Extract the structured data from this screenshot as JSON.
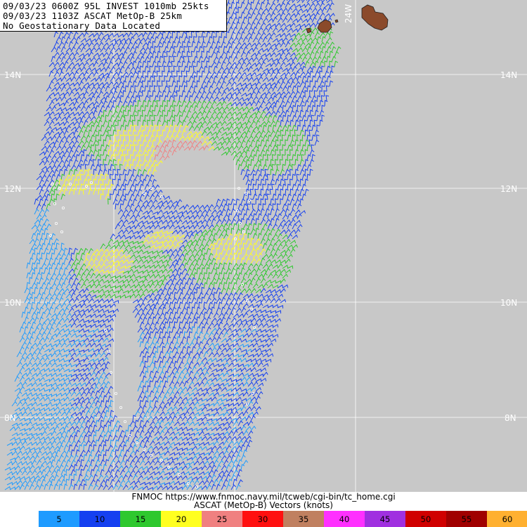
{
  "header": {
    "line1": "09/03/23 0600Z  95L INVEST 1010mb 25kts",
    "line2": "09/03/23 1103Z  ASCAT MetOp-B 25km",
    "line3": "No Geostationary Data Located"
  },
  "map": {
    "lat_labels": [
      "14N",
      "12N",
      "10N",
      "8N"
    ],
    "lon_labels": [
      "24W"
    ],
    "land_color": "#8b4a2b",
    "background_color": "#c8c8c8",
    "grid_color": "#ffffff"
  },
  "footer": {
    "url_line": "FNMOC https://www.fnmoc.navy.mil/tcweb/cgi-bin/tc_home.cgi",
    "legend_title": "ASCAT (MetOp-B) Vectors (knots)"
  },
  "legend": [
    {
      "label": "5",
      "color": "#1e9bff"
    },
    {
      "label": "10",
      "color": "#1540f0"
    },
    {
      "label": "15",
      "color": "#2ec82e"
    },
    {
      "label": "20",
      "color": "#ffff20"
    },
    {
      "label": "25",
      "color": "#f08080"
    },
    {
      "label": "30",
      "color": "#ff1010"
    },
    {
      "label": "35",
      "color": "#c08060"
    },
    {
      "label": "40",
      "color": "#ff30ff"
    },
    {
      "label": "45",
      "color": "#a030e0"
    },
    {
      "label": "50",
      "color": "#d00000"
    },
    {
      "label": "55",
      "color": "#a00000"
    },
    {
      "label": "60",
      "color": "#ffb030"
    }
  ]
}
